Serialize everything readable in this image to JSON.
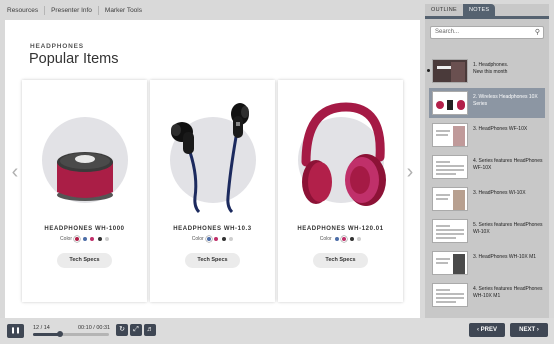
{
  "topnav": {
    "items": [
      "Resources",
      "Presenter Info",
      "Marker Tools"
    ]
  },
  "stage": {
    "brand": "HEADPHONES",
    "heading": "Popular Items",
    "prev_icon": "chevron-left-icon",
    "next_icon": "chevron-right-icon",
    "cards": [
      {
        "name": "HEADPHONES WH-1000",
        "color_label": "Color",
        "colors": [
          "#b2204a",
          "#4d6ea8",
          "#c0306a",
          "#333333",
          "#cfcfcf"
        ],
        "specs_label": "Tech Specs"
      },
      {
        "name": "HEADPHONES WH-10.3",
        "color_label": "Color",
        "colors": [
          "#4d6ea8",
          "#c0306a",
          "#333333",
          "#cfcfcf"
        ],
        "specs_label": "Tech Specs"
      },
      {
        "name": "HEADPHONES WH-120.01",
        "color_label": "Color",
        "colors": [
          "#4d6ea8",
          "#c0306a",
          "#333333",
          "#cfcfcf"
        ],
        "specs_label": "Tech Specs"
      }
    ]
  },
  "panel": {
    "tabs": [
      "OUTLINE",
      "NOTES"
    ],
    "search_placeholder": "Search...",
    "slides": [
      "1. Headphones.\nNew this month",
      "2. Wireless Headphones 10X Series",
      "3. HeadPhones WF-10X",
      "4. Series features HeadPhones WF-10X",
      "3. HeadPhones WI-10X",
      "5. Series features HeadPhones WI-10X",
      "3. HeadPhones WH-10X M1",
      "4. Series features HeadPhones WH-10X M1"
    ]
  },
  "player": {
    "slide_count": "12 / 14",
    "time": "00:10 / 00:31",
    "progress": 0.36,
    "prev_label": "PREV",
    "next_label": "NEXT"
  },
  "colors": {
    "accent": "#3f4754",
    "product": "#b2204a"
  }
}
